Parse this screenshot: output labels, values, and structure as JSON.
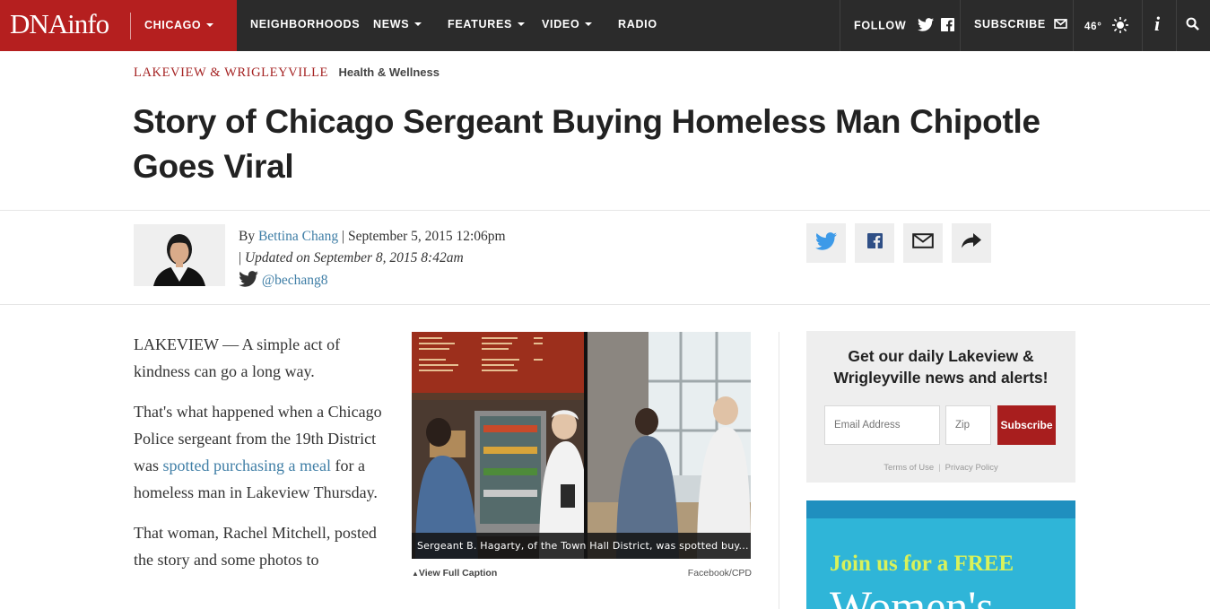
{
  "nav": {
    "logo": "DNAinfo",
    "city": "CHICAGO",
    "items": [
      {
        "label": "NEIGHBORHOODS",
        "dropdown": false
      },
      {
        "label": "NEWS",
        "dropdown": true
      },
      {
        "label": "FEATURES",
        "dropdown": true
      },
      {
        "label": "VIDEO",
        "dropdown": true
      },
      {
        "label": "RADIO",
        "dropdown": false
      }
    ],
    "follow_label": "FOLLOW",
    "subscribe_label": "SUBSCRIBE",
    "weather_temp": "46°",
    "icons": [
      "twitter-icon",
      "facebook-icon",
      "mail-icon",
      "sun-icon",
      "info-icon",
      "search-icon"
    ],
    "colors": {
      "bar": "#2b2b2b",
      "brand": "#b51f1f"
    }
  },
  "article": {
    "breadcrumb_main": "LAKEVIEW & WRIGLEYVILLE",
    "breadcrumb_sub": "Health & Wellness",
    "headline": "Story of Chicago Sergeant Buying Homeless Man Chipotle Goes Viral",
    "byline": {
      "by": "By",
      "author": "Bettina Chang",
      "date": "September 5, 2015 12:06pm",
      "updated": "Updated on September 8, 2015 8:42am",
      "twitter": "@bechang8"
    },
    "share_icons": [
      "twitter-icon",
      "facebook-icon",
      "mail-icon",
      "share-arrow-icon"
    ],
    "paragraphs": {
      "p1": "LAKEVIEW — A simple act of kindness can go a long way.",
      "p2_before": "That's what happened when a Chicago Police sergeant from the 19th District was ",
      "p2_link": "spotted purchasing a meal",
      "p2_after": " for a homeless man in Lakeview Thursday.",
      "p3": "That woman, Rachel Mitchell, posted the story and some photos to"
    },
    "photo": {
      "caption": "Sergeant B. Hagarty, of the Town Hall District, was spotted buy...",
      "view_caption": "View Full Caption",
      "credit": "Facebook/CPD"
    }
  },
  "sidebar": {
    "signup_title": "Get our daily Lakeview & Wrigleyville news and alerts!",
    "email_placeholder": "Email Address",
    "zip_placeholder": "Zip",
    "subscribe_button": "Subscribe",
    "terms": "Terms of Use",
    "privacy": "Privacy Policy",
    "promo_line1": "Join us for a FREE",
    "promo_line2": "Women's"
  }
}
